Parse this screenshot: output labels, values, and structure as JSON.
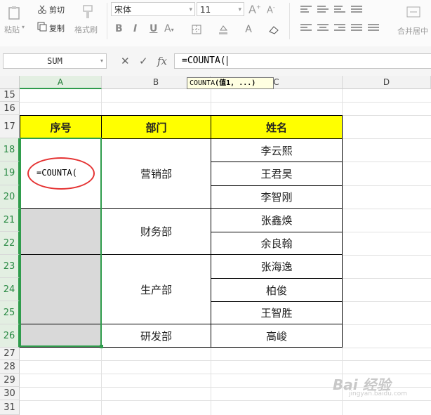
{
  "toolbar": {
    "paste_label": "粘贴",
    "cut_label": "剪切",
    "copy_label": "复制",
    "format_painter_label": "格式刷",
    "font_name": "宋体",
    "font_size": "11",
    "bold": "B",
    "italic": "I",
    "underline": "U",
    "merge_center_label": "合并居中"
  },
  "formula_bar": {
    "name_box": "SUM",
    "formula": "=COUNTA(",
    "cancel_icon": "✕",
    "confirm_icon": "✓",
    "fx_label": "fx"
  },
  "tooltip": {
    "fn": "COUNTA",
    "args": "(值1, ...)"
  },
  "columns": [
    "A",
    "B",
    "C",
    "D"
  ],
  "rows": [
    "15",
    "16",
    "17",
    "18",
    "19",
    "20",
    "21",
    "22",
    "23",
    "24",
    "25",
    "26",
    "27",
    "28",
    "29",
    "30",
    "31"
  ],
  "table": {
    "header_seq": "序号",
    "header_dept": "部门",
    "header_name": "姓名",
    "editing_text": "=COUNTA(",
    "depts": [
      "营销部",
      "财务部",
      "生产部",
      "研发部"
    ],
    "names": [
      "李云熙",
      "王君昊",
      "李智刚",
      "张鑫焕",
      "余良翰",
      "张海逸",
      "柏俊",
      "王智胜",
      "高峻"
    ]
  },
  "colors": {
    "header_fill": "#ffff00",
    "selection_green": "#2f9c4c",
    "annotation_red": "#e53333",
    "empty_fill": "#d9d9d9"
  },
  "watermark": {
    "text": "Bai 经验",
    "sub": "jingyan.baidu.com"
  }
}
